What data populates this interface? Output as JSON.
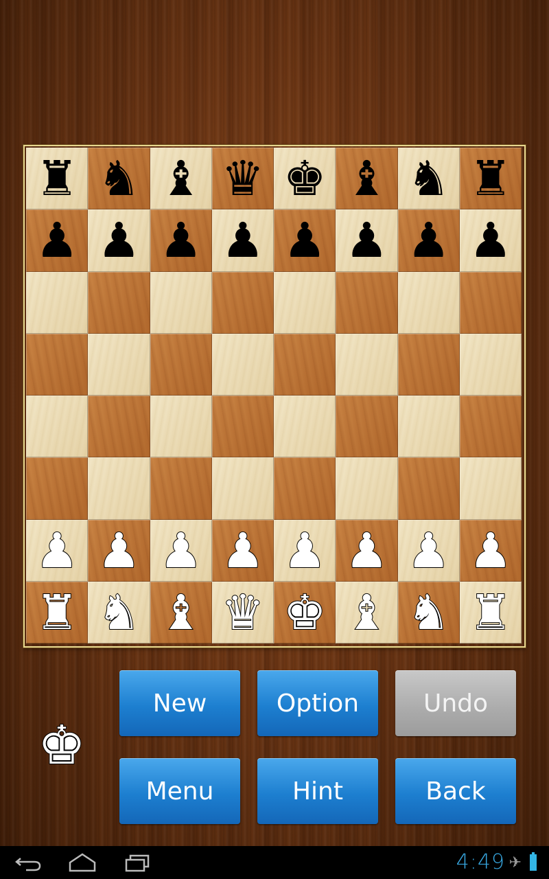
{
  "board": {
    "squares": [
      [
        "br",
        "bn",
        "bb",
        "bq",
        "bk",
        "bb",
        "bn",
        "br"
      ],
      [
        "bp",
        "bp",
        "bp",
        "bp",
        "bp",
        "bp",
        "bp",
        "bp"
      ],
      [
        "",
        "",
        "",
        "",
        "",
        "",
        "",
        ""
      ],
      [
        "",
        "",
        "",
        "",
        "",
        "",
        "",
        ""
      ],
      [
        "",
        "",
        "",
        "",
        "",
        "",
        "",
        ""
      ],
      [
        "",
        "",
        "",
        "",
        "",
        "",
        "",
        ""
      ],
      [
        "wp",
        "wp",
        "wp",
        "wp",
        "wp",
        "wp",
        "wp",
        "wp"
      ],
      [
        "wr",
        "wn",
        "wb",
        "wq",
        "wk",
        "wb",
        "wn",
        "wr"
      ]
    ],
    "glyphs": {
      "k": "♚",
      "q": "♛",
      "r": "♜",
      "b": "♝",
      "n": "♞",
      "p": "♟"
    },
    "colors": {
      "light": "#ecdcb8",
      "dark": "#bf7a3c",
      "frame": "#e8d890"
    }
  },
  "turn_indicator": {
    "side": "white",
    "piece": "king",
    "glyph": "♚"
  },
  "buttons": [
    {
      "id": "new",
      "label": "New",
      "enabled": true
    },
    {
      "id": "option",
      "label": "Option",
      "enabled": true
    },
    {
      "id": "undo",
      "label": "Undo",
      "enabled": false
    },
    {
      "id": "menu",
      "label": "Menu",
      "enabled": true
    },
    {
      "id": "hint",
      "label": "Hint",
      "enabled": true
    },
    {
      "id": "back",
      "label": "Back",
      "enabled": true
    }
  ],
  "button_colors": {
    "primary": "#1d7fd0",
    "disabled": "#ababab"
  },
  "status_bar": {
    "nav": [
      "back-icon",
      "home-icon",
      "recent-apps-icon"
    ],
    "time": "4:49",
    "time_color": "#37a6df",
    "airplane_mode": true,
    "battery": "full"
  }
}
